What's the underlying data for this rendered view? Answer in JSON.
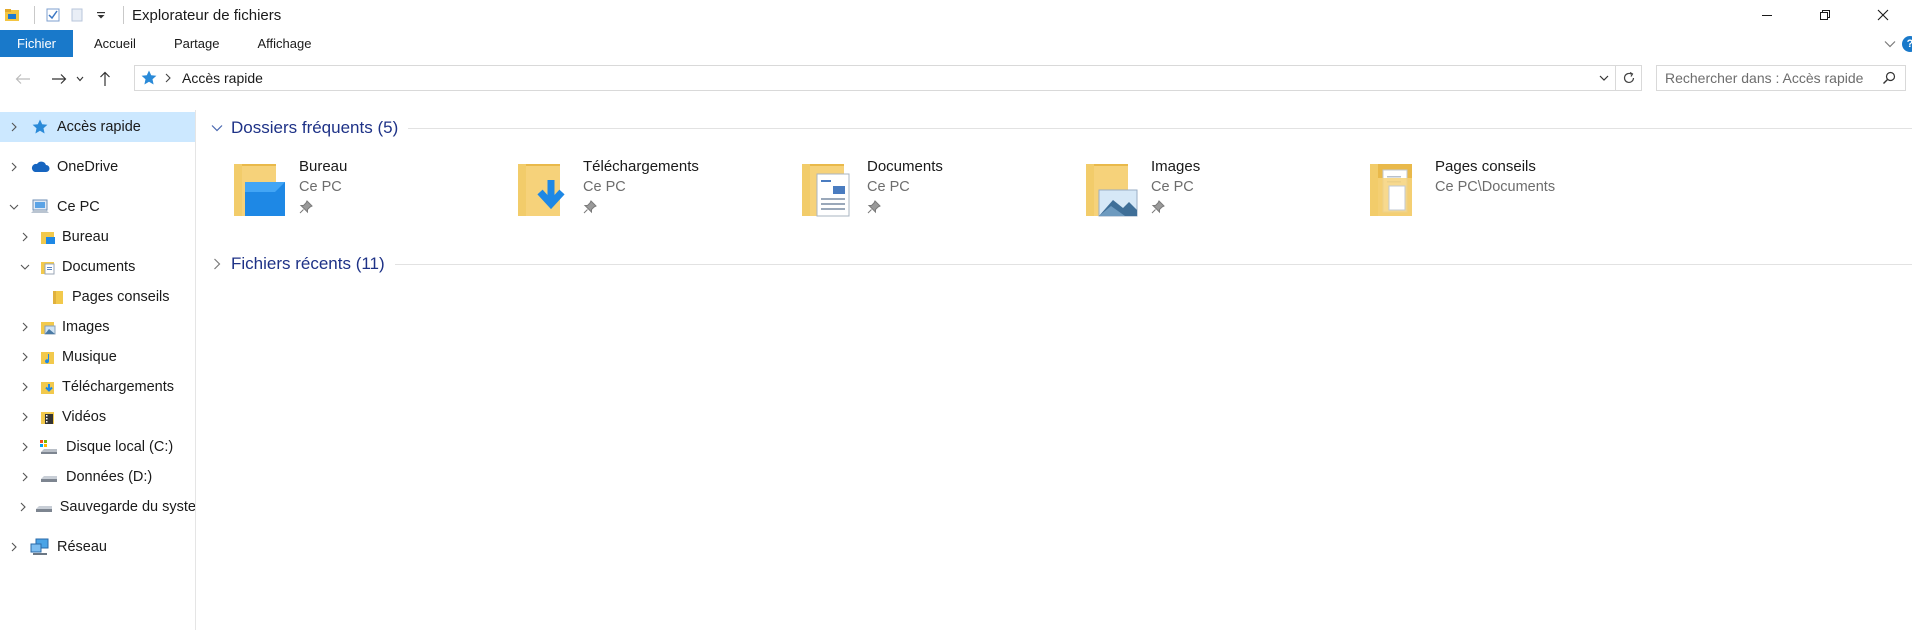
{
  "window": {
    "title": "Explorateur de fichiers",
    "accent_color": "#1979ca",
    "icons": [
      "window-icon",
      "properties-icon",
      "new-folder-icon",
      "customize-qat-icon"
    ],
    "controls": [
      "minimize-icon",
      "restore-icon",
      "close-icon"
    ]
  },
  "ribbon": {
    "tabs": [
      {
        "label": "Fichier",
        "active": true
      },
      {
        "label": "Accueil",
        "active": false
      },
      {
        "label": "Partage",
        "active": false
      },
      {
        "label": "Affichage",
        "active": false
      }
    ],
    "help": "?"
  },
  "navigation": {
    "buttons": [
      "back-icon",
      "forward-icon",
      "recent-locations-icon",
      "up-icon"
    ],
    "address": {
      "icon": "quick-access-star-icon",
      "path": "Accès rapide"
    },
    "search_placeholder": "Rechercher dans : Accès rapide"
  },
  "sidebar": {
    "items": [
      {
        "label": "Accès rapide",
        "icon": "quick-access-star-icon",
        "expander": "collapsed",
        "level": 0,
        "selected": true
      },
      {
        "label": "OneDrive",
        "icon": "onedrive-cloud-icon",
        "expander": "collapsed",
        "level": 0,
        "selected": false
      },
      {
        "label": "Ce PC",
        "icon": "this-pc-icon",
        "expander": "expanded",
        "level": 0,
        "selected": false
      },
      {
        "label": "Bureau",
        "icon": "desktop-folder-icon",
        "expander": "collapsed",
        "level": 1,
        "selected": false
      },
      {
        "label": "Documents",
        "icon": "documents-folder-icon",
        "expander": "expanded",
        "level": 1,
        "selected": false
      },
      {
        "label": "Pages conseils",
        "icon": "folder-icon",
        "expander": "none",
        "level": 2,
        "selected": false
      },
      {
        "label": "Images",
        "icon": "pictures-folder-icon",
        "expander": "collapsed",
        "level": 1,
        "selected": false
      },
      {
        "label": "Musique",
        "icon": "music-folder-icon",
        "expander": "collapsed",
        "level": 1,
        "selected": false
      },
      {
        "label": "Téléchargements",
        "icon": "downloads-folder-icon",
        "expander": "collapsed",
        "level": 1,
        "selected": false
      },
      {
        "label": "Vidéos",
        "icon": "videos-folder-icon",
        "expander": "collapsed",
        "level": 1,
        "selected": false
      },
      {
        "label": "Disque local (C:)",
        "icon": "system-drive-icon",
        "expander": "collapsed",
        "level": 1,
        "selected": false
      },
      {
        "label": "Données (D:)",
        "icon": "drive-icon",
        "expander": "collapsed",
        "level": 1,
        "selected": false
      },
      {
        "label": "Sauvegarde du syste",
        "icon": "drive-icon",
        "expander": "collapsed",
        "level": 1,
        "selected": false
      },
      {
        "label": "Réseau",
        "icon": "network-icon",
        "expander": "collapsed",
        "level": 0,
        "selected": false
      }
    ]
  },
  "content": {
    "groups": [
      {
        "title": "Dossiers fréquents (5)",
        "expanded": true,
        "items": [
          {
            "name": "Bureau",
            "location": "Ce PC",
            "pinned": true,
            "icon": "desktop-folder-icon"
          },
          {
            "name": "Téléchargements",
            "location": "Ce PC",
            "pinned": true,
            "icon": "downloads-folder-icon"
          },
          {
            "name": "Documents",
            "location": "Ce PC",
            "pinned": true,
            "icon": "documents-folder-icon"
          },
          {
            "name": "Images",
            "location": "Ce PC",
            "pinned": true,
            "icon": "pictures-folder-icon"
          },
          {
            "name": "Pages conseils",
            "location": "Ce PC\\Documents",
            "pinned": false,
            "icon": "folder-icon"
          }
        ]
      },
      {
        "title": "Fichiers récents (11)",
        "expanded": false,
        "items": []
      }
    ]
  }
}
